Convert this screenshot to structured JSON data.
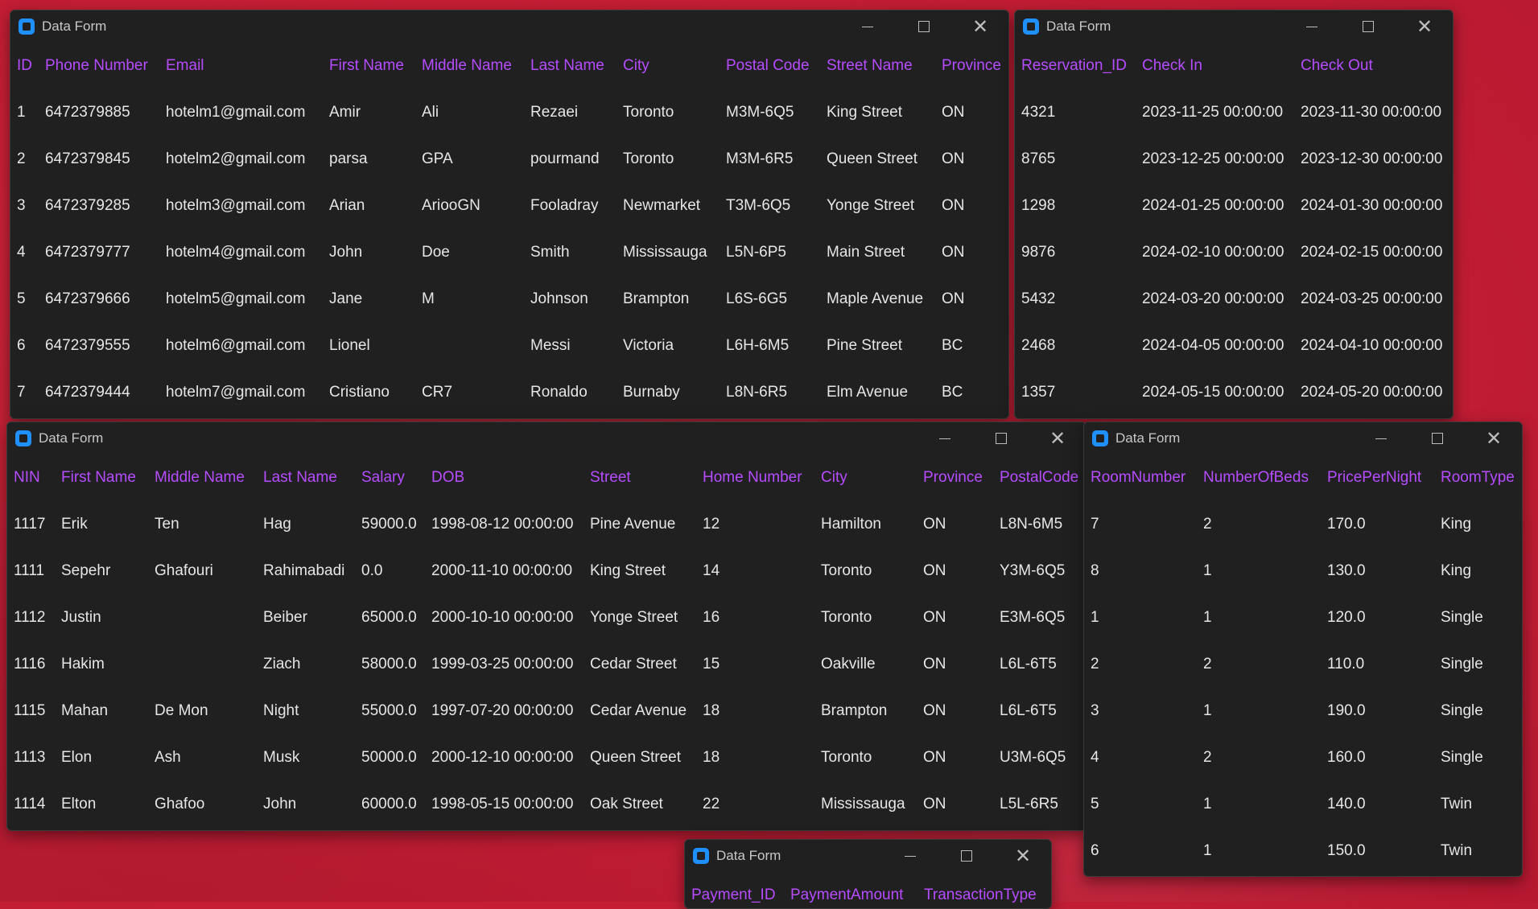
{
  "colors": {
    "desktop_bg": "#c81f36",
    "window_bg": "#202020",
    "header_text": "#b64cff",
    "cell_text": "#e6e6e6",
    "app_icon": "#1e90ff"
  },
  "icons": {
    "app": "data-form-app-icon",
    "minimize": "minimize-icon",
    "maximize": "maximize-icon",
    "close": "close-icon"
  },
  "windows": {
    "hotel": {
      "title": "Data Form",
      "columns": [
        "ID",
        "Phone Number",
        "Email",
        "First Name",
        "Middle Name",
        "Last Name",
        "City",
        "Postal Code",
        "Street Name",
        "Province"
      ],
      "rows": [
        [
          "1",
          "6472379885",
          "hotelm1@gmail.com",
          "Amir",
          "Ali",
          "Rezaei",
          "Toronto",
          "M3M-6Q5",
          "King Street",
          "ON"
        ],
        [
          "2",
          "6472379845",
          "hotelm2@gmail.com",
          "parsa",
          "GPA",
          "pourmand",
          "Toronto",
          "M3M-6R5",
          "Queen Street",
          "ON"
        ],
        [
          "3",
          "6472379285",
          "hotelm3@gmail.com",
          "Arian",
          "ArioоGN",
          "Fooladray",
          "Newmarket",
          "T3M-6Q5",
          "Yonge Street",
          "ON"
        ],
        [
          "4",
          "6472379777",
          "hotelm4@gmail.com",
          "John",
          "Doe",
          "Smith",
          "Mississauga",
          "L5N-6P5",
          "Main Street",
          "ON"
        ],
        [
          "5",
          "6472379666",
          "hotelm5@gmail.com",
          "Jane",
          "M",
          "Johnson",
          "Brampton",
          "L6S-6G5",
          "Maple Avenue",
          "ON"
        ],
        [
          "6",
          "6472379555",
          "hotelm6@gmail.com",
          "Lionel",
          "",
          "Messi",
          "Victoria",
          "L6H-6M5",
          "Pine Street",
          "BC"
        ],
        [
          "7",
          "6472379444",
          "hotelm7@gmail.com",
          "Cristiano",
          "CR7",
          "Ronaldo",
          "Burnaby",
          "L8N-6R5",
          "Elm Avenue",
          "BC"
        ]
      ]
    },
    "reservation": {
      "title": "Data Form",
      "columns": [
        "Reservation_ID",
        "Check In",
        "Check Out"
      ],
      "rows": [
        [
          "4321",
          "2023-11-25 00:00:00",
          "2023-11-30 00:00:00"
        ],
        [
          "8765",
          "2023-12-25 00:00:00",
          "2023-12-30 00:00:00"
        ],
        [
          "1298",
          "2024-01-25 00:00:00",
          "2024-01-30 00:00:00"
        ],
        [
          "9876",
          "2024-02-10 00:00:00",
          "2024-02-15 00:00:00"
        ],
        [
          "5432",
          "2024-03-20 00:00:00",
          "2024-03-25 00:00:00"
        ],
        [
          "2468",
          "2024-04-05 00:00:00",
          "2024-04-10 00:00:00"
        ],
        [
          "1357",
          "2024-05-15 00:00:00",
          "2024-05-20 00:00:00"
        ]
      ]
    },
    "employee": {
      "title": "Data Form",
      "columns": [
        "NIN",
        "First Name",
        "Middle Name",
        "Last Name",
        "Salary",
        "DOB",
        "Street",
        "Home Number",
        "City",
        "Province",
        "PostalCode"
      ],
      "rows": [
        [
          "1117",
          "Erik",
          "Ten",
          "Hag",
          "59000.0",
          "1998-08-12 00:00:00",
          "Pine Avenue",
          "12",
          "Hamilton",
          "ON",
          "L8N-6M5"
        ],
        [
          "1111",
          "Sepehr",
          "Ghafouri",
          "Rahimabadi",
          "0.0",
          "2000-11-10 00:00:00",
          "King Street",
          "14",
          "Toronto",
          "ON",
          "Y3M-6Q5"
        ],
        [
          "1112",
          "Justin",
          "",
          "Beiber",
          "65000.0",
          "2000-10-10 00:00:00",
          "Yonge Street",
          "16",
          "Toronto",
          "ON",
          "E3M-6Q5"
        ],
        [
          "1116",
          "Hakim",
          "",
          "Ziach",
          "58000.0",
          "1999-03-25 00:00:00",
          "Cedar Street",
          "15",
          "Oakville",
          "ON",
          "L6L-6T5"
        ],
        [
          "1115",
          "Mahan",
          "De Mon",
          "Night",
          "55000.0",
          "1997-07-20 00:00:00",
          "Cedar Avenue",
          "18",
          "Brampton",
          "ON",
          "L6L-6T5"
        ],
        [
          "1113",
          "Elon",
          "Ash",
          "Musk",
          "50000.0",
          "2000-12-10 00:00:00",
          "Queen Street",
          "18",
          "Toronto",
          "ON",
          "U3M-6Q5"
        ],
        [
          "1114",
          "Elton",
          "Ghafoo",
          "John",
          "60000.0",
          "1998-05-15 00:00:00",
          "Oak Street",
          "22",
          "Mississauga",
          "ON",
          "L5L-6R5"
        ]
      ]
    },
    "room": {
      "title": "Data Form",
      "columns": [
        "RoomNumber",
        "NumberOfBeds",
        "PricePerNight",
        "RoomType"
      ],
      "rows": [
        [
          "7",
          "2",
          "170.0",
          "King"
        ],
        [
          "8",
          "1",
          "130.0",
          "King"
        ],
        [
          "1",
          "1",
          "120.0",
          "Single"
        ],
        [
          "2",
          "2",
          "110.0",
          "Single"
        ],
        [
          "3",
          "1",
          "190.0",
          "Single"
        ],
        [
          "4",
          "2",
          "160.0",
          "Single"
        ],
        [
          "5",
          "1",
          "140.0",
          "Twin"
        ],
        [
          "6",
          "1",
          "150.0",
          "Twin"
        ]
      ]
    },
    "payment": {
      "title": "Data Form",
      "columns": [
        "Payment_ID",
        "PaymentAmount",
        "TransactionType"
      ],
      "rows": []
    }
  }
}
